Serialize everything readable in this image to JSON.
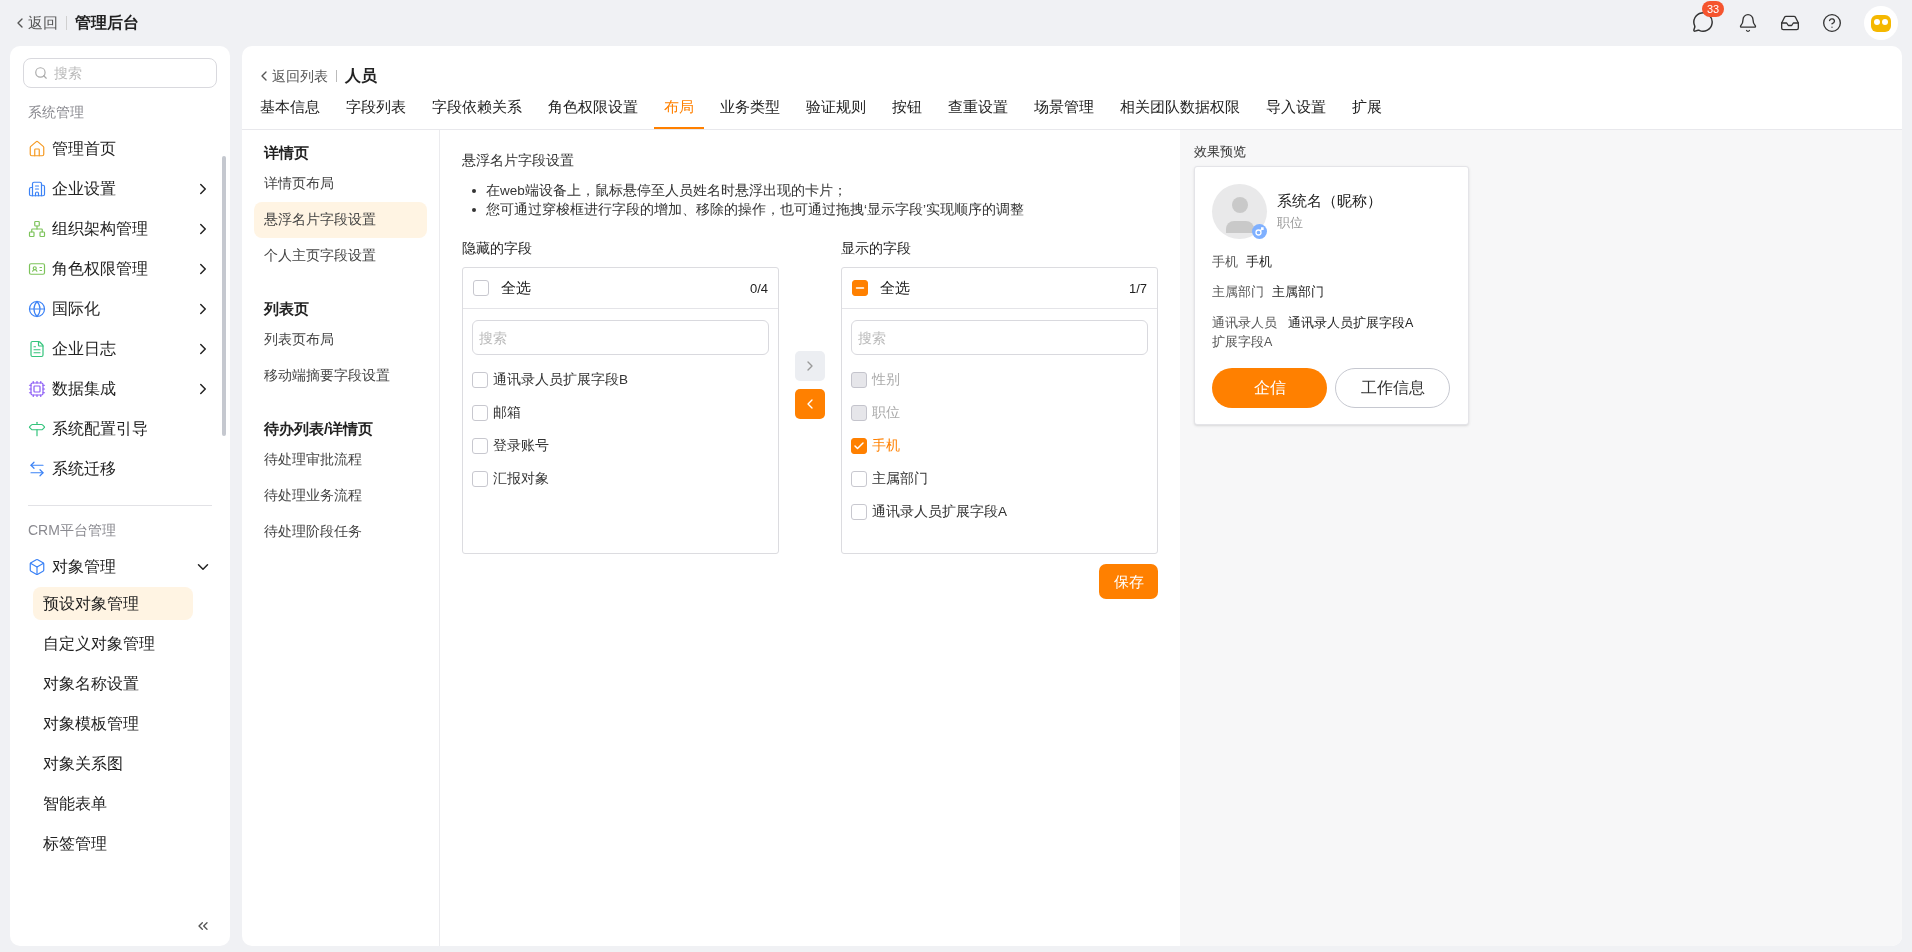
{
  "topbar": {
    "back": "返回",
    "title": "管理后台",
    "message_badge": "33"
  },
  "sidebar": {
    "search_placeholder": "搜索",
    "sections": [
      {
        "title": "系统管理",
        "items": [
          {
            "label": "管理首页"
          },
          {
            "label": "企业设置",
            "expanded": false
          },
          {
            "label": "组织架构管理",
            "expanded": false
          },
          {
            "label": "角色权限管理",
            "expanded": false
          },
          {
            "label": "国际化",
            "expanded": false
          },
          {
            "label": "企业日志",
            "expanded": false
          },
          {
            "label": "数据集成",
            "expanded": false
          },
          {
            "label": "系统配置引导"
          },
          {
            "label": "系统迁移"
          }
        ]
      },
      {
        "title": "CRM平台管理",
        "items": [
          {
            "label": "对象管理",
            "expanded": true,
            "children": [
              {
                "label": "预设对象管理",
                "selected": true
              },
              {
                "label": "自定义对象管理",
                "selected": false
              },
              {
                "label": "对象名称设置",
                "selected": false
              },
              {
                "label": "对象模板管理",
                "selected": false
              },
              {
                "label": "对象关系图",
                "selected": false
              },
              {
                "label": "智能表单",
                "selected": false
              },
              {
                "label": "标签管理",
                "selected": false
              }
            ]
          }
        ]
      }
    ]
  },
  "page": {
    "back": "返回列表",
    "title": "人员",
    "tabs": [
      {
        "label": "基本信息",
        "selected": false
      },
      {
        "label": "字段列表",
        "selected": false
      },
      {
        "label": "字段依赖关系",
        "selected": false
      },
      {
        "label": "角色权限设置",
        "selected": false
      },
      {
        "label": "布局",
        "selected": true
      },
      {
        "label": "业务类型",
        "selected": false
      },
      {
        "label": "验证规则",
        "selected": false
      },
      {
        "label": "按钮",
        "selected": false
      },
      {
        "label": "查重设置",
        "selected": false
      },
      {
        "label": "场景管理",
        "selected": false
      },
      {
        "label": "相关团队数据权限",
        "selected": false
      },
      {
        "label": "导入设置",
        "selected": false
      },
      {
        "label": "扩展",
        "selected": false
      }
    ],
    "nav": [
      {
        "title": "详情页",
        "items": [
          {
            "label": "详情页布局",
            "selected": false
          },
          {
            "label": "悬浮名片字段设置",
            "selected": true
          },
          {
            "label": "个人主页字段设置",
            "selected": false
          }
        ]
      },
      {
        "title": "列表页",
        "items": [
          {
            "label": "列表页布局",
            "selected": false
          },
          {
            "label": "移动端摘要字段设置",
            "selected": false
          }
        ]
      },
      {
        "title": "待办列表/详情页",
        "items": [
          {
            "label": "待处理审批流程",
            "selected": false
          },
          {
            "label": "待处理业务流程",
            "selected": false
          },
          {
            "label": "待处理阶段任务",
            "selected": false
          }
        ]
      }
    ],
    "settings": {
      "title": "悬浮名片字段设置",
      "notes": [
        "在web端设备上，鼠标悬停至人员姓名时悬浮出现的卡片；",
        "您可通过穿梭框进行字段的增加、移除的操作，也可通过拖拽‘显示字段’实现顺序的调整"
      ],
      "lists": [
        {
          "title": "隐藏的字段",
          "select_all": "全选",
          "partial": false,
          "count": "0/4",
          "search_placeholder": "搜索",
          "items": [
            {
              "label": "通讯录人员扩展字段B",
              "checked": false,
              "disabled": false
            },
            {
              "label": "邮箱",
              "checked": false,
              "disabled": false
            },
            {
              "label": "登录账号",
              "checked": false,
              "disabled": false
            },
            {
              "label": "汇报对象",
              "checked": false,
              "disabled": false
            }
          ]
        },
        {
          "title": "显示的字段",
          "select_all": "全选",
          "partial": true,
          "count": "1/7",
          "search_placeholder": "搜索",
          "items": [
            {
              "label": "性别",
              "checked": false,
              "disabled": true
            },
            {
              "label": "职位",
              "checked": false,
              "disabled": true
            },
            {
              "label": "手机",
              "checked": true,
              "disabled": false
            },
            {
              "label": "主属部门",
              "checked": false,
              "disabled": false
            },
            {
              "label": "通讯录人员扩展字段A",
              "checked": false,
              "disabled": false
            }
          ]
        }
      ],
      "move_right_disabled": true,
      "move_left_disabled": false,
      "save": "保存"
    },
    "preview": {
      "label": "效果预览",
      "name": "系统名（昵称）",
      "position": "职位",
      "fields": [
        {
          "label": "手机",
          "value": "手机"
        },
        {
          "label": "主属部门",
          "value": "主属部门"
        },
        {
          "label": "通讯录人员扩展字段A",
          "value": "通讯录人员扩展字段A"
        }
      ],
      "primary_button": "企信",
      "secondary_button": "工作信息"
    }
  }
}
